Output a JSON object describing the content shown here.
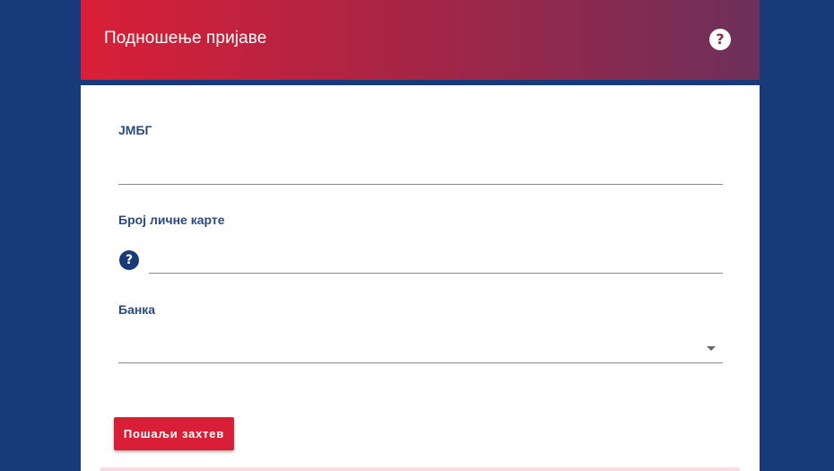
{
  "header": {
    "title": "Подношење пријаве",
    "help_icon": "question-circle-icon"
  },
  "form": {
    "jmbg": {
      "label": "ЈМБГ",
      "value": ""
    },
    "id_card": {
      "label": "Број личне карте",
      "value": "",
      "help_icon": "question-circle-icon"
    },
    "bank": {
      "label": "Банка",
      "selected": "",
      "icon": "caret-down-icon"
    },
    "submit_label": "Пошаљи захтев"
  },
  "colors": {
    "background": "#183a78",
    "header_start": "#d91f37",
    "header_end": "#6c305a",
    "label": "#2b4a7e",
    "button": "#d91f37"
  }
}
